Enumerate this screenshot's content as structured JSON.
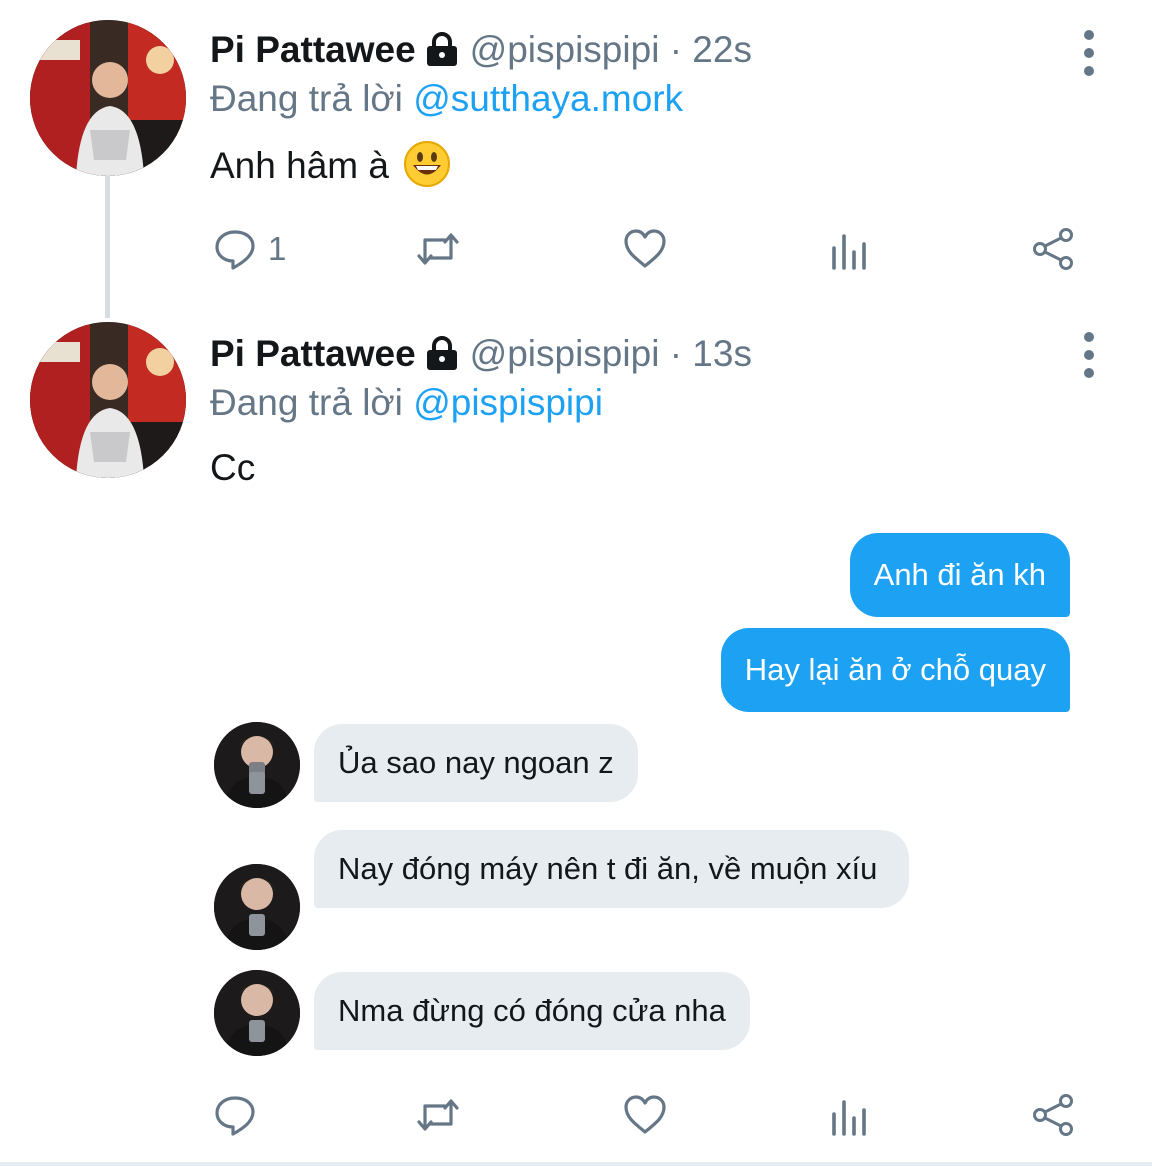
{
  "tweets": [
    {
      "author_name": "Pi Pattawee",
      "handle": "@pispispipi",
      "time": "· 22s",
      "reply_prefix": "Đang trả lời",
      "reply_to": "@sutthaya.mork",
      "text": "Anh hâm à",
      "emoji": "grinning-face",
      "reply_count": "1"
    },
    {
      "author_name": "Pi Pattawee",
      "handle": "@pispispipi",
      "time": "· 13s",
      "reply_prefix": "Đang trả lời",
      "reply_to": "@pispispipi",
      "text": "Cc"
    }
  ],
  "messages": {
    "outgoing": [
      "Anh đi ăn kh",
      "Hay lại ăn ở chỗ quay"
    ],
    "incoming": [
      "Ủa sao nay ngoan z",
      "Nay đóng máy nên t đi ăn, về muộn xíu",
      "Nma đừng có đóng cửa nha"
    ]
  },
  "icons": [
    "lock-icon",
    "more-icon",
    "reply-icon",
    "retweet-icon",
    "like-icon",
    "analytics-icon",
    "share-icon"
  ],
  "colors": {
    "accent": "#1da1f2",
    "muted": "#657786",
    "bubble_in": "#e6ecf0",
    "text": "#14171a"
  }
}
